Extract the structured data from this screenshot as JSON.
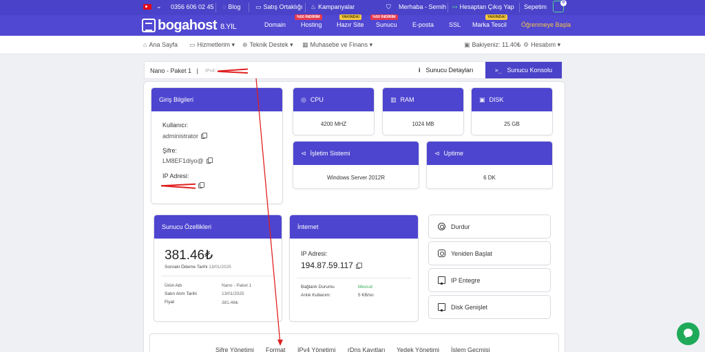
{
  "topbar": {
    "phone": "0356 606 02 45",
    "blog": "Blog",
    "affiliate": "Satış Ortaklığı",
    "campaigns": "Kampanyalar",
    "greeting": "Merhaba - Semih",
    "logout": "Hesaptan Çıkış Yap",
    "cart": "Sepetim",
    "cart_count": "0"
  },
  "navbar": {
    "logo": "bogahost",
    "logo_suffix": "8.YIL",
    "items": [
      {
        "label": "Domain",
        "badge": ""
      },
      {
        "label": "Hosting",
        "badge": "%50 İNDİRİM"
      },
      {
        "label": "Hazır Site",
        "badge": "YAKINDA!"
      },
      {
        "label": "Sunucu",
        "badge": "%50 İNDİRİM"
      },
      {
        "label": "E-posta",
        "badge": ""
      },
      {
        "label": "SSL",
        "badge": ""
      },
      {
        "label": "Marka Tescil",
        "badge": "YAKINDA!"
      },
      {
        "label": "Öğrenmeye Başla",
        "badge": ""
      }
    ]
  },
  "subnav": {
    "home": "Ana Sayfa",
    "services": "Hizmetlerim",
    "support": "Teknik Destek",
    "accounting": "Muhasebe ve Finans",
    "balance": "Bakiyeniz: 11.40₺",
    "account": "Hesabım"
  },
  "server": {
    "name": "Nano - Paket 1",
    "separator": "|",
    "ip_label": "IPv4:",
    "details_btn": "Sunucu Detayları",
    "console_btn": "Sunucu Konsolu"
  },
  "login": {
    "title": "Giriş Bilgileri",
    "user_label": "Kullanıcı:",
    "user_value": "administrator",
    "pass_label": "Şifre:",
    "pass_value": "LM8EF1diyo@",
    "ip_label": "IP Adresi:"
  },
  "stats": {
    "cpu_title": "CPU",
    "cpu_value": "4200 MHZ",
    "ram_title": "RAM",
    "ram_value": "1024 MB",
    "disk_title": "DISK",
    "disk_value": "25 GB",
    "os_title": "İşletim Sistemi",
    "os_value": "Windows Server 2012R",
    "uptime_title": "Uptime",
    "uptime_value": "6 DK"
  },
  "features": {
    "title": "Sunucu Özellikleri",
    "price": "381.46₺",
    "next_payment_label": "Sonraki Ödeme Tarihi",
    "next_payment_date": "13/01/2025",
    "rows": [
      {
        "label": "Ürün Adı",
        "value": "Nano - Paket 1"
      },
      {
        "label": "Satın Alım Tarihi",
        "value": "13/01/2025"
      },
      {
        "label": "Fiyat",
        "value": "381.46₺"
      }
    ]
  },
  "internet": {
    "title": "İnternet",
    "ip_label": "IP Adresi:",
    "ip_value": "194.87.59.117",
    "status_label": "Bağlantı Durumu",
    "status_value": "Mevcut",
    "usage_label": "Anlık Kullanım:",
    "usage_value": "5 KB/sn"
  },
  "actions": {
    "stop": "Durdur",
    "restart": "Yeniden Başlat",
    "ip_integrate": "IP Entegre",
    "disk_expand": "Disk Genişlet"
  },
  "tabs": [
    "Şifre Yönetimi",
    "Format",
    "IPv4 Yönetimi",
    "rDns Kayıtları",
    "Yedek Yönetimi",
    "İşlem Geçmişi"
  ],
  "colors": {
    "primary": "#4a42c8",
    "accent": "#f5c842",
    "badge_red": "#e8394d",
    "success": "#2fa84f",
    "chat": "#1faa59",
    "annotation": "#e02020"
  }
}
